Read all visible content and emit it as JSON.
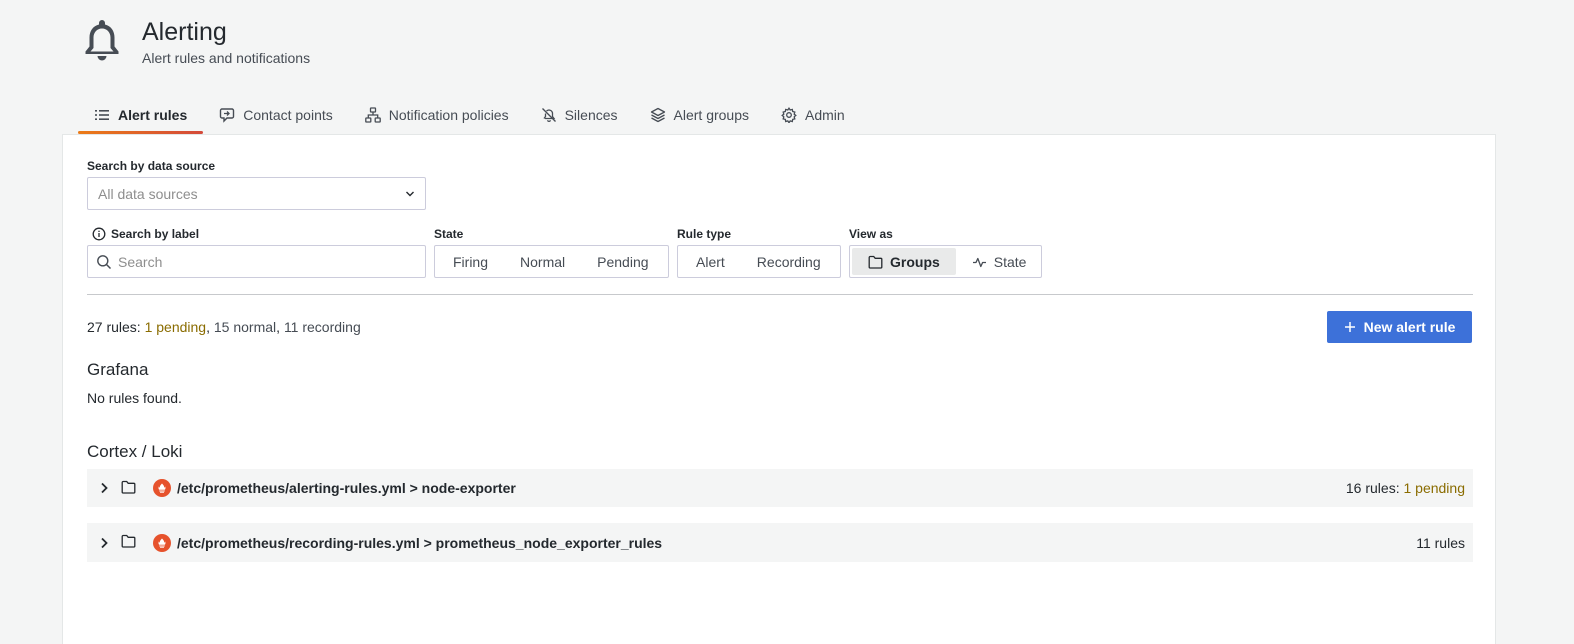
{
  "header": {
    "title": "Alerting",
    "subtitle": "Alert rules and notifications"
  },
  "tabs": [
    {
      "label": "Alert rules",
      "icon": "list-icon",
      "active": true
    },
    {
      "label": "Contact points",
      "icon": "comment-alt-share-icon",
      "active": false
    },
    {
      "label": "Notification policies",
      "icon": "sitemap-icon",
      "active": false
    },
    {
      "label": "Silences",
      "icon": "bell-slash-icon",
      "active": false
    },
    {
      "label": "Alert groups",
      "icon": "layer-group-icon",
      "active": false
    },
    {
      "label": "Admin",
      "icon": "cog-icon",
      "active": false
    }
  ],
  "filters": {
    "datasource_label": "Search by data source",
    "datasource_placeholder": "All data sources",
    "label_search_label": "Search by label",
    "label_search_placeholder": "Search",
    "state_label": "State",
    "state_options": [
      "Firing",
      "Normal",
      "Pending"
    ],
    "rule_type_label": "Rule type",
    "rule_type_options": [
      "Alert",
      "Recording"
    ],
    "view_as_label": "View as",
    "view_as_options": [
      {
        "label": "Groups",
        "icon": "folder-icon",
        "selected": true
      },
      {
        "label": "State",
        "icon": "heart-rate-icon",
        "selected": false
      }
    ]
  },
  "summary": {
    "prefix": "27 rules: ",
    "pending": "1 pending",
    "sep1": ", ",
    "normal": "15 normal",
    "sep2": ", ",
    "recording": "11 recording"
  },
  "new_rule_button": "New alert rule",
  "sections": {
    "grafana_title": "Grafana",
    "grafana_empty": "No rules found.",
    "cortex_title": "Cortex / Loki"
  },
  "groups": [
    {
      "name": "/etc/prometheus/alerting-rules.yml > node-exporter",
      "count_prefix": "16 rules: ",
      "count_pending": "1 pending"
    },
    {
      "name": "/etc/prometheus/recording-rules.yml > prometheus_node_exporter_rules",
      "count_prefix": "11 rules",
      "count_pending": ""
    }
  ],
  "colors": {
    "primary": "#3d71d9",
    "pending": "#8a6c00",
    "prometheus": "#e6522c"
  }
}
